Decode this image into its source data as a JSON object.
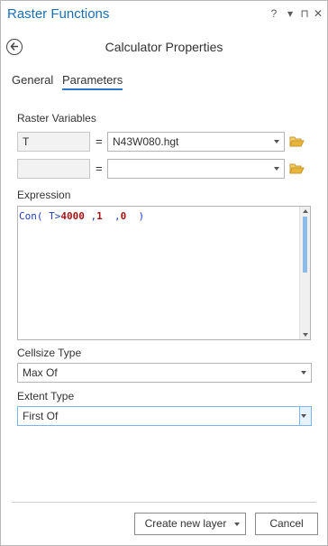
{
  "window": {
    "title": "Raster Functions",
    "help_label": "?",
    "menu_label": "▾",
    "pin_label": "⊓",
    "close_label": "✕"
  },
  "header": {
    "title": "Calculator Properties"
  },
  "tabs": [
    {
      "label": "General",
      "active": false
    },
    {
      "label": "Parameters",
      "active": true
    }
  ],
  "raster_variables": {
    "label": "Raster Variables",
    "rows": [
      {
        "variable": "T",
        "equals": "=",
        "value": "N43W080.hgt"
      },
      {
        "variable": "",
        "equals": "=",
        "value": ""
      }
    ]
  },
  "expression": {
    "label": "Expression",
    "tokens": {
      "func": "Con( ",
      "var": "T",
      "op": ">",
      "n1": "4000",
      "sep1": " ,",
      "n2": "1",
      "sep2": "  ,",
      "n3": "0",
      "close": "  )"
    }
  },
  "cellsize_type": {
    "label": "Cellsize Type",
    "value": "Max Of"
  },
  "extent_type": {
    "label": "Extent Type",
    "value": "First Of"
  },
  "footer": {
    "create_label": "Create new layer",
    "cancel_label": "Cancel"
  },
  "colors": {
    "title_blue": "#1c6fb4",
    "tab_underline": "#2a78c5",
    "expr_keyword": "#1f3ec7",
    "expr_number": "#a31515",
    "scroll_thumb": "#8cbbe8",
    "folder": "#e8b53a"
  },
  "icons": {
    "back": "back-arrow-circle-icon",
    "folder": "folder-open-icon"
  }
}
